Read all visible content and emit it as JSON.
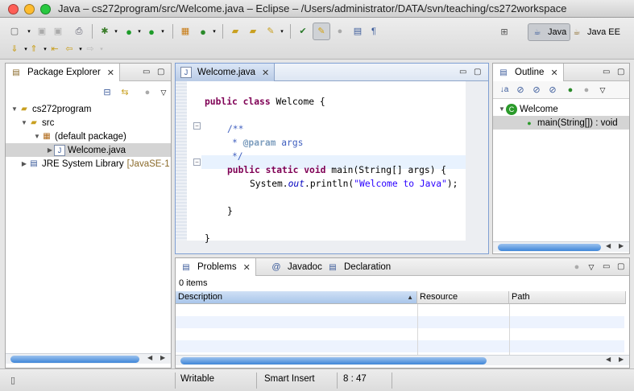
{
  "window": {
    "title": "Java – cs272program/src/Welcome.java – Eclipse – /Users/administrator/DATA/svn/teaching/cs272workspace",
    "traffic_colors": [
      "#ff5f57",
      "#febc2e",
      "#28c840"
    ]
  },
  "perspectives": [
    {
      "label": "Java",
      "active": true
    },
    {
      "label": "Java EE",
      "active": false
    }
  ],
  "package_explorer": {
    "tab_label": "Package Explorer",
    "tree": [
      {
        "label": "cs272program",
        "icon": "project-icon",
        "level": 0,
        "expanded": true
      },
      {
        "label": "src",
        "icon": "source-folder-icon",
        "level": 1,
        "expanded": true
      },
      {
        "label": "(default package)",
        "icon": "package-icon",
        "level": 2,
        "expanded": true
      },
      {
        "label": "Welcome.java",
        "icon": "java-file-icon",
        "level": 3,
        "expanded": false,
        "selected": true
      },
      {
        "label": "JRE System Library",
        "suffix": "[JavaSE-1",
        "icon": "library-icon",
        "level": 1,
        "expanded": false
      }
    ]
  },
  "editor": {
    "tab_label": "Welcome.java",
    "lines": [
      "public class Welcome {",
      "",
      "    /**",
      "     * @param args",
      "     */",
      "    public static void main(String[] args) {",
      "        System.out.println(\"Welcome to Java\");",
      "",
      "    }",
      "",
      "}"
    ],
    "tokens": {
      "kw_public": "public",
      "kw_class": "class",
      "kw_static": "static",
      "kw_void": "void",
      "class_name": " Welcome {",
      "doc_open": "/**",
      "doc_star": "* ",
      "param_tag": "@param",
      "param_name": " args",
      "doc_close": "*/",
      "main_sig": " main(String[] args) {",
      "sys": "System.",
      "out": "out",
      "println": ".println(",
      "str": "\"Welcome to Java\"",
      "close_call": ");",
      "brace": "}"
    }
  },
  "outline": {
    "tab_label": "Outline",
    "items": [
      {
        "label": "Welcome",
        "icon": "class-icon"
      },
      {
        "label": "main(String[]) : void",
        "icon": "method-icon",
        "selected": true
      }
    ]
  },
  "bottom": {
    "tabs": [
      {
        "label": "Problems",
        "icon": "problems-icon"
      },
      {
        "label": "Javadoc",
        "icon": "javadoc-icon"
      },
      {
        "label": "Declaration",
        "icon": "declaration-icon"
      }
    ],
    "count_text": "0 items",
    "columns": [
      "Description",
      "Resource",
      "Path"
    ]
  },
  "status": {
    "writable": "Writable",
    "insert_mode": "Smart Insert",
    "position": "8 : 47"
  }
}
